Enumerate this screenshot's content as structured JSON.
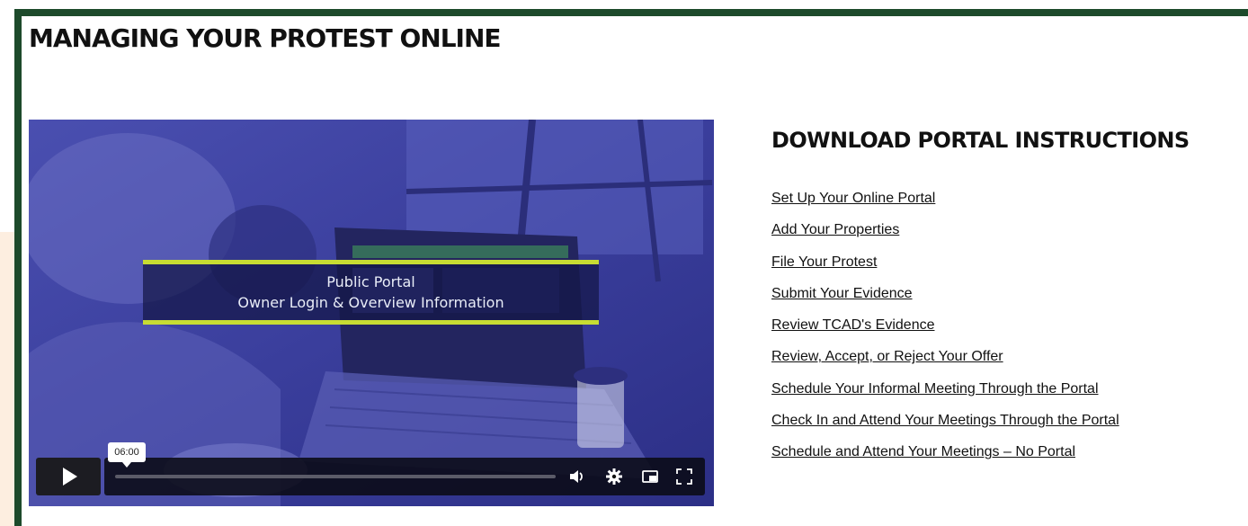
{
  "page": {
    "title": "MANAGING YOUR PROTEST ONLINE",
    "accent_color": "#1d4a2b"
  },
  "video": {
    "overlay_title_line1": "Public Portal",
    "overlay_title_line2": "Owner Login & Overview Information",
    "overlay_accent_color": "#c7dc33",
    "hover_time": "06:00",
    "progress": 0.0,
    "controls": {
      "play": "play-icon",
      "volume": "volume-icon",
      "settings": "gear-icon",
      "pip": "picture-in-picture-icon",
      "fullscreen": "fullscreen-icon"
    }
  },
  "downloads": {
    "heading": "DOWNLOAD PORTAL INSTRUCTIONS",
    "links": [
      "Set Up Your Online Portal",
      "Add Your Properties",
      "File Your Protest",
      "Submit Your Evidence",
      "Review TCAD's Evidence",
      "Review, Accept, or Reject Your Offer",
      "Schedule Your Informal Meeting Through the Portal",
      "Check In and Attend Your Meetings Through the Portal",
      "Schedule and Attend Your Meetings – No Portal"
    ]
  }
}
